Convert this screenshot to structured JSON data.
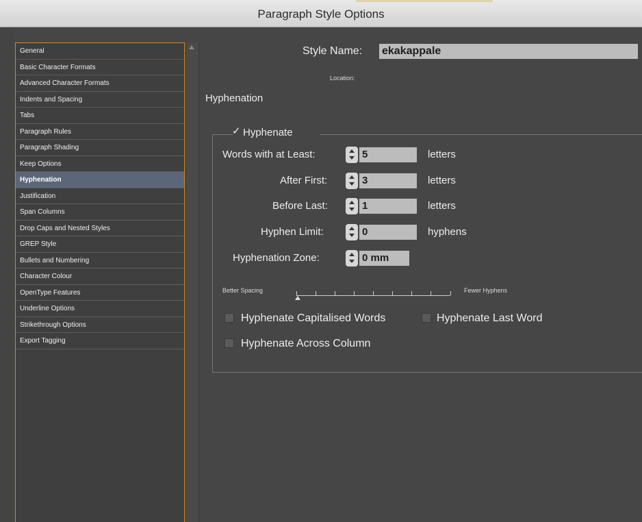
{
  "window": {
    "title": "Paragraph Style Options"
  },
  "sidebar": {
    "items": [
      {
        "label": "General"
      },
      {
        "label": "Basic Character Formats"
      },
      {
        "label": "Advanced Character Formats"
      },
      {
        "label": "Indents and Spacing"
      },
      {
        "label": "Tabs"
      },
      {
        "label": "Paragraph Rules"
      },
      {
        "label": "Paragraph Shading"
      },
      {
        "label": "Keep Options"
      },
      {
        "label": "Hyphenation"
      },
      {
        "label": "Justification"
      },
      {
        "label": "Span Columns"
      },
      {
        "label": "Drop Caps and Nested Styles"
      },
      {
        "label": "GREP Style"
      },
      {
        "label": "Bullets and Numbering"
      },
      {
        "label": "Character Colour"
      },
      {
        "label": "OpenType Features"
      },
      {
        "label": "Underline Options"
      },
      {
        "label": "Strikethrough Options"
      },
      {
        "label": "Export Tagging"
      }
    ],
    "selected": "Hyphenation"
  },
  "style": {
    "name_label": "Style Name:",
    "name_value": "ekakappale",
    "location_label": "Location:"
  },
  "section": {
    "title": "Hyphenation"
  },
  "hyphenate": {
    "label": "Hyphenate",
    "checked": true
  },
  "fields": {
    "words_at_least": {
      "label": "Words with at Least:",
      "value": "5",
      "unit": "letters"
    },
    "after_first": {
      "label": "After First:",
      "value": "3",
      "unit": "letters"
    },
    "before_last": {
      "label": "Before Last:",
      "value": "1",
      "unit": "letters"
    },
    "hyphen_limit": {
      "label": "Hyphen Limit:",
      "value": "0",
      "unit": "hyphens"
    },
    "hyphenation_zone": {
      "label": "Hyphenation Zone:",
      "value": "0 mm"
    }
  },
  "slider": {
    "left_label": "Better Spacing",
    "right_label": "Fewer Hyphens",
    "position": 0
  },
  "options": {
    "capitalised": {
      "label": "Hyphenate Capitalised Words",
      "checked": false
    },
    "last_word": {
      "label": "Hyphenate Last Word",
      "checked": false
    },
    "across_column": {
      "label": "Hyphenate Across Column",
      "checked": false
    }
  },
  "colors": {
    "accent_border": "#d38a1f",
    "selection": "#5b6778",
    "background": "#464646"
  }
}
